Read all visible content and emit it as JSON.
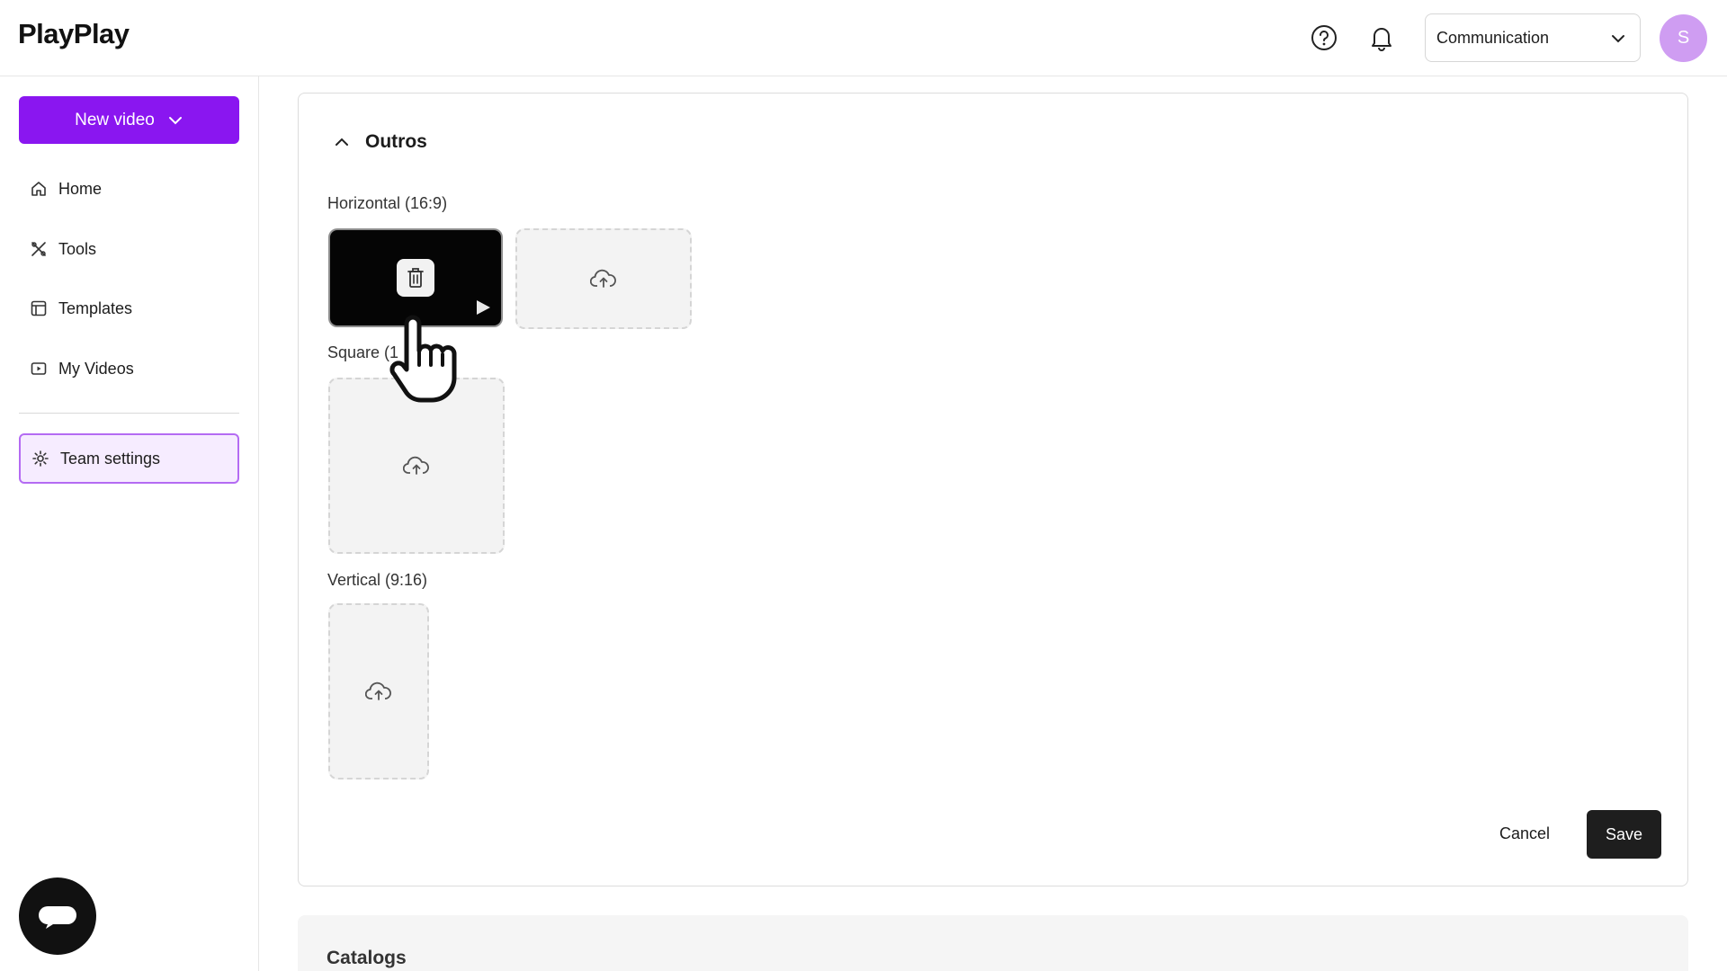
{
  "header": {
    "logo": "PlayPlay",
    "team_select": {
      "value": "Communication"
    },
    "avatar_initial": "S"
  },
  "sidebar": {
    "new_video_label": "New video",
    "items": [
      {
        "label": "Home",
        "icon": "home-icon"
      },
      {
        "label": "Tools",
        "icon": "tools-icon"
      },
      {
        "label": "Templates",
        "icon": "templates-icon"
      },
      {
        "label": "My Videos",
        "icon": "videos-icon"
      }
    ],
    "team_settings_label": "Team settings"
  },
  "panel": {
    "section_title": "Outros",
    "groups": [
      {
        "label": "Horizontal (16:9)"
      },
      {
        "label": "Square (1"
      },
      {
        "label": "Vertical (9:16)"
      }
    ],
    "cancel_label": "Cancel",
    "save_label": "Save"
  },
  "catalogs": {
    "title": "Catalogs"
  },
  "colors": {
    "accent": "#8a16f0",
    "active_border": "#b46bf3",
    "active_bg": "#f6ecff",
    "avatar": "#cf9df2",
    "save_button": "#1e1e1e"
  }
}
